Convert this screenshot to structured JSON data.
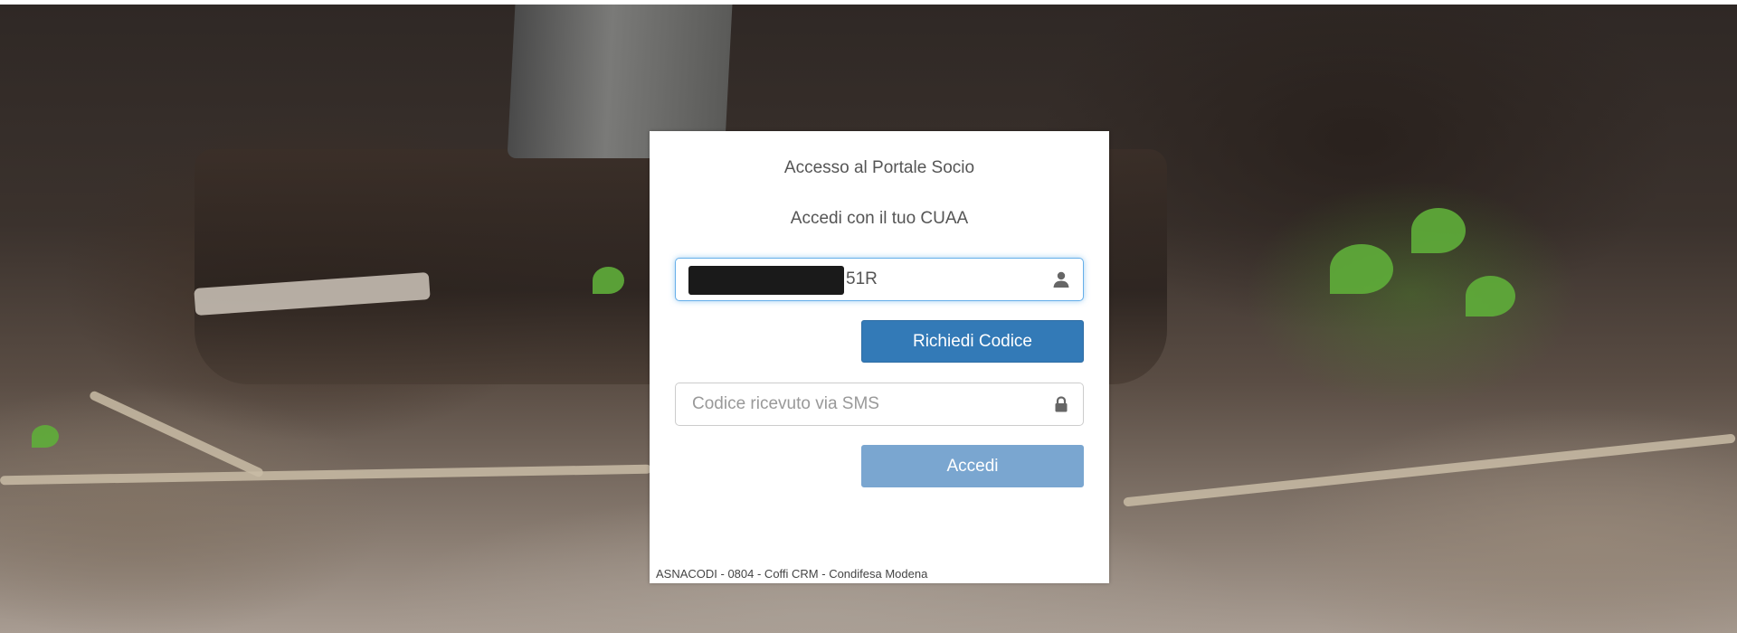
{
  "login": {
    "title": "Accesso al Portale Socio",
    "subtitle": "Accedi con il tuo CUAA",
    "cuaa_value": "51R",
    "cuaa_icon": "user-icon",
    "request_button": "Richiedi Codice",
    "code_placeholder": "Codice ricevuto via SMS",
    "code_icon": "lock-icon",
    "login_button": "Accedi",
    "footer": "ASNACODI - 0804 - Coffi CRM - Condifesa Modena"
  },
  "colors": {
    "primary": "#337ab7",
    "primary_disabled": "#7aa6d0",
    "focus": "#66afe9"
  }
}
